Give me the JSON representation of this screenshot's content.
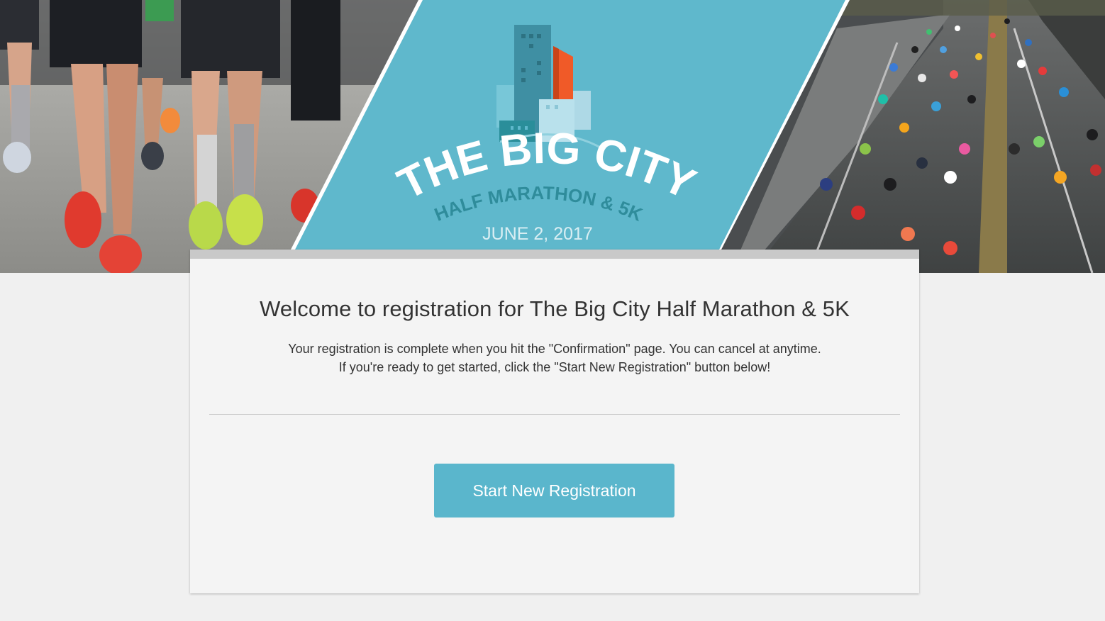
{
  "banner": {
    "logo": {
      "line1": "THE BIG CITY",
      "line2": "HALF MARATHON & 5K",
      "date": "JUNE 2, 2017"
    },
    "colors": {
      "teal": "#5fb8cc",
      "orange": "#f05a28",
      "darkTeal": "#2f8c9b"
    }
  },
  "card": {
    "title": "Welcome to registration for The Big City Half Marathon & 5K",
    "line1": "Your registration is complete when you hit the \"Confirmation\" page. You can cancel at anytime.",
    "line2": "If you're ready to get started, click the \"Start New Registration\" button below!",
    "button_label": "Start New Registration",
    "accent": "#5ab6cc"
  }
}
